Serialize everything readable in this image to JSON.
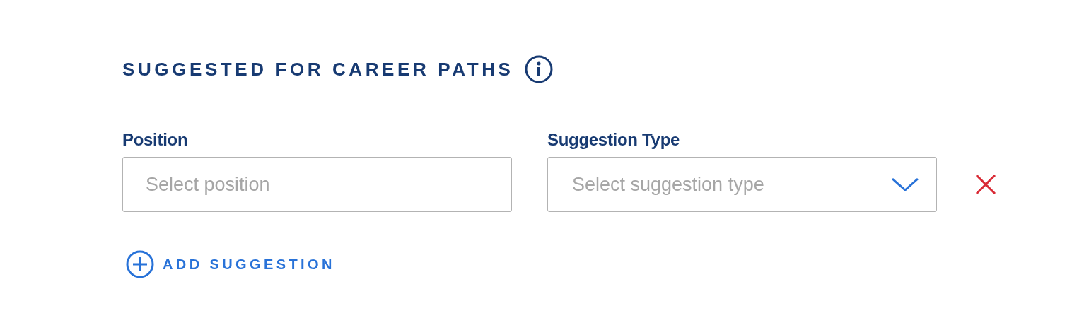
{
  "section": {
    "title": "SUGGESTED FOR CAREER PATHS"
  },
  "fields": [
    {
      "kind": "text",
      "label": "Position",
      "placeholder": "Select position"
    },
    {
      "kind": "select",
      "label": "Suggestion Type",
      "placeholder": "Select suggestion type"
    }
  ],
  "add_button": {
    "label": "ADD SUGGESTION"
  }
}
